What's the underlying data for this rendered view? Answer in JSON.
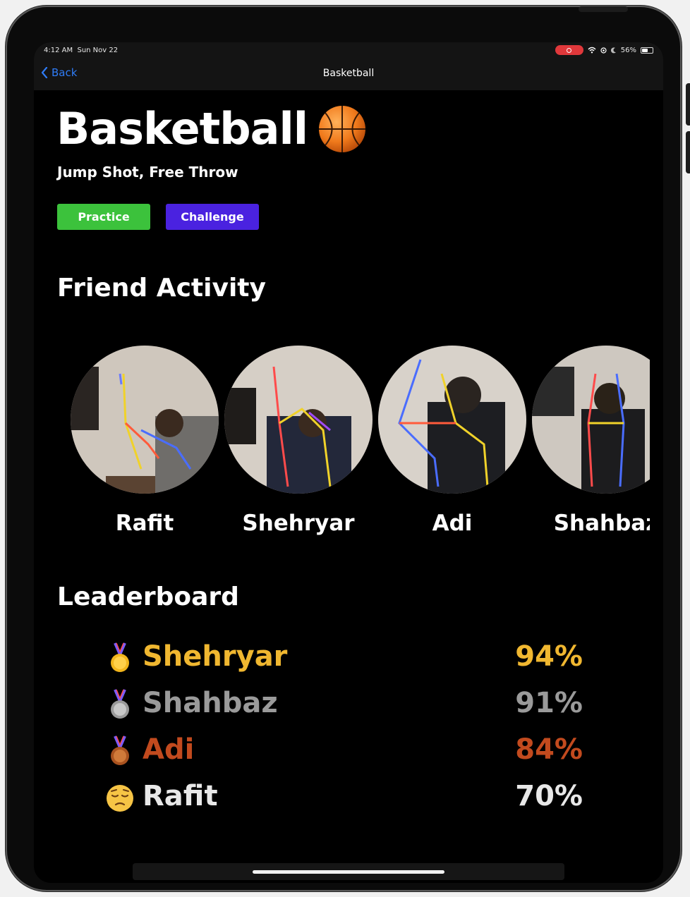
{
  "status": {
    "time": "4:12 AM",
    "date": "Sun Nov 22",
    "battery": "56%",
    "battery_level": 0.56
  },
  "nav": {
    "back_label": "Back",
    "title": "Basketball"
  },
  "header": {
    "title": "Basketball",
    "title_icon": "basketball-emoji",
    "subtitle": "Jump Shot, Free Throw"
  },
  "buttons": {
    "practice": {
      "label": "Practice",
      "color": "#3cc23c"
    },
    "challenge": {
      "label": "Challenge",
      "color": "#4a22e0"
    }
  },
  "friend_activity": {
    "title": "Friend Activity",
    "friends": [
      {
        "name": "Rafit"
      },
      {
        "name": "Shehryar"
      },
      {
        "name": "Adi"
      },
      {
        "name": "Shahbaz"
      }
    ]
  },
  "leaderboard": {
    "title": "Leaderboard",
    "rows": [
      {
        "icon": "gold-medal-icon",
        "name": "Shehryar",
        "score": "94%",
        "color": "#f0b730"
      },
      {
        "icon": "silver-medal-icon",
        "name": "Shahbaz",
        "score": "91%",
        "color": "#9a9a9a"
      },
      {
        "icon": "bronze-medal-icon",
        "name": "Adi",
        "score": "84%",
        "color": "#c24a1e"
      },
      {
        "icon": "pensive-face-icon",
        "name": "Rafit",
        "score": "70%",
        "color": "#e8e8e8"
      }
    ]
  }
}
